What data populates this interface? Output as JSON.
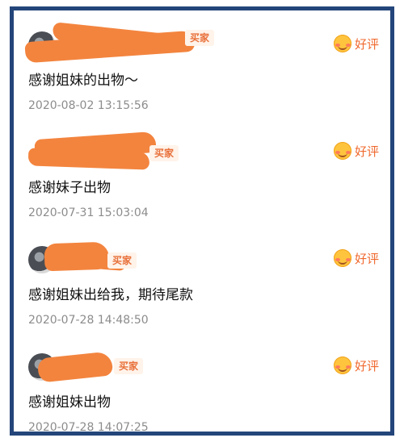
{
  "reviews": [
    {
      "buyer_label": "买家",
      "rating_label": "好评",
      "comment": "感谢姐妹的出物～",
      "time": "2020-08-02 13:15:56"
    },
    {
      "buyer_label": "买家",
      "rating_label": "好评",
      "comment": "感谢妹子出物",
      "time": "2020-07-31 15:03:04"
    },
    {
      "buyer_label": "买家",
      "rating_label": "好评",
      "comment": "感谢姐妹出给我，期待尾款",
      "time": "2020-07-28 14:48:50"
    },
    {
      "buyer_label": "买家",
      "rating_label": "好评",
      "comment": "感谢姐妹出物",
      "time": "2020-07-28 14:07:25"
    }
  ],
  "colors": {
    "frame": "#23457a",
    "redaction": "#f3843e",
    "rating": "#f0692f",
    "badge_text": "#e8703a",
    "badge_bg": "#fff3ea",
    "timestamp": "#8c8c8c"
  }
}
